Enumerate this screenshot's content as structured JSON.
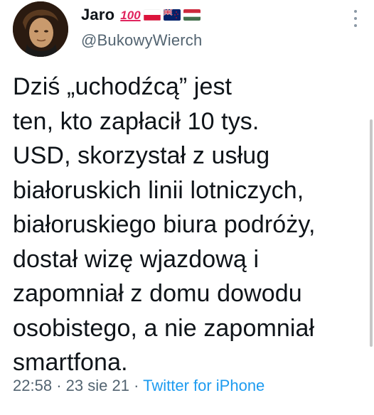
{
  "author": {
    "display_name": "Jaro",
    "handle": "@BukowyWierch",
    "badges": [
      "100-emoji",
      "poland-flag",
      "new-zealand-flag",
      "hungary-flag"
    ],
    "badge_100_text": "100"
  },
  "tweet": {
    "text": "Dziś „uchodźcą” jest\nten, kto zapłacił 10 tys.\nUSD, skorzystał z usług\nbiałoruskich linii lotniczych,\nbiałoruskiego biura podróży,\ndostał wizę wjazdową i\nzapomniał z domu dowodu\nosobistego, a nie zapomniał\nsmartfona."
  },
  "meta": {
    "time": "22:58",
    "separator": "·",
    "date": "23 sie 21",
    "source": "Twitter for iPhone"
  },
  "colors": {
    "text": "#0f1419",
    "secondary": "#536471",
    "link": "#1d9bf0",
    "emoji_100": "#e0245e"
  },
  "icons": {
    "more": "more-vertical-icon"
  }
}
